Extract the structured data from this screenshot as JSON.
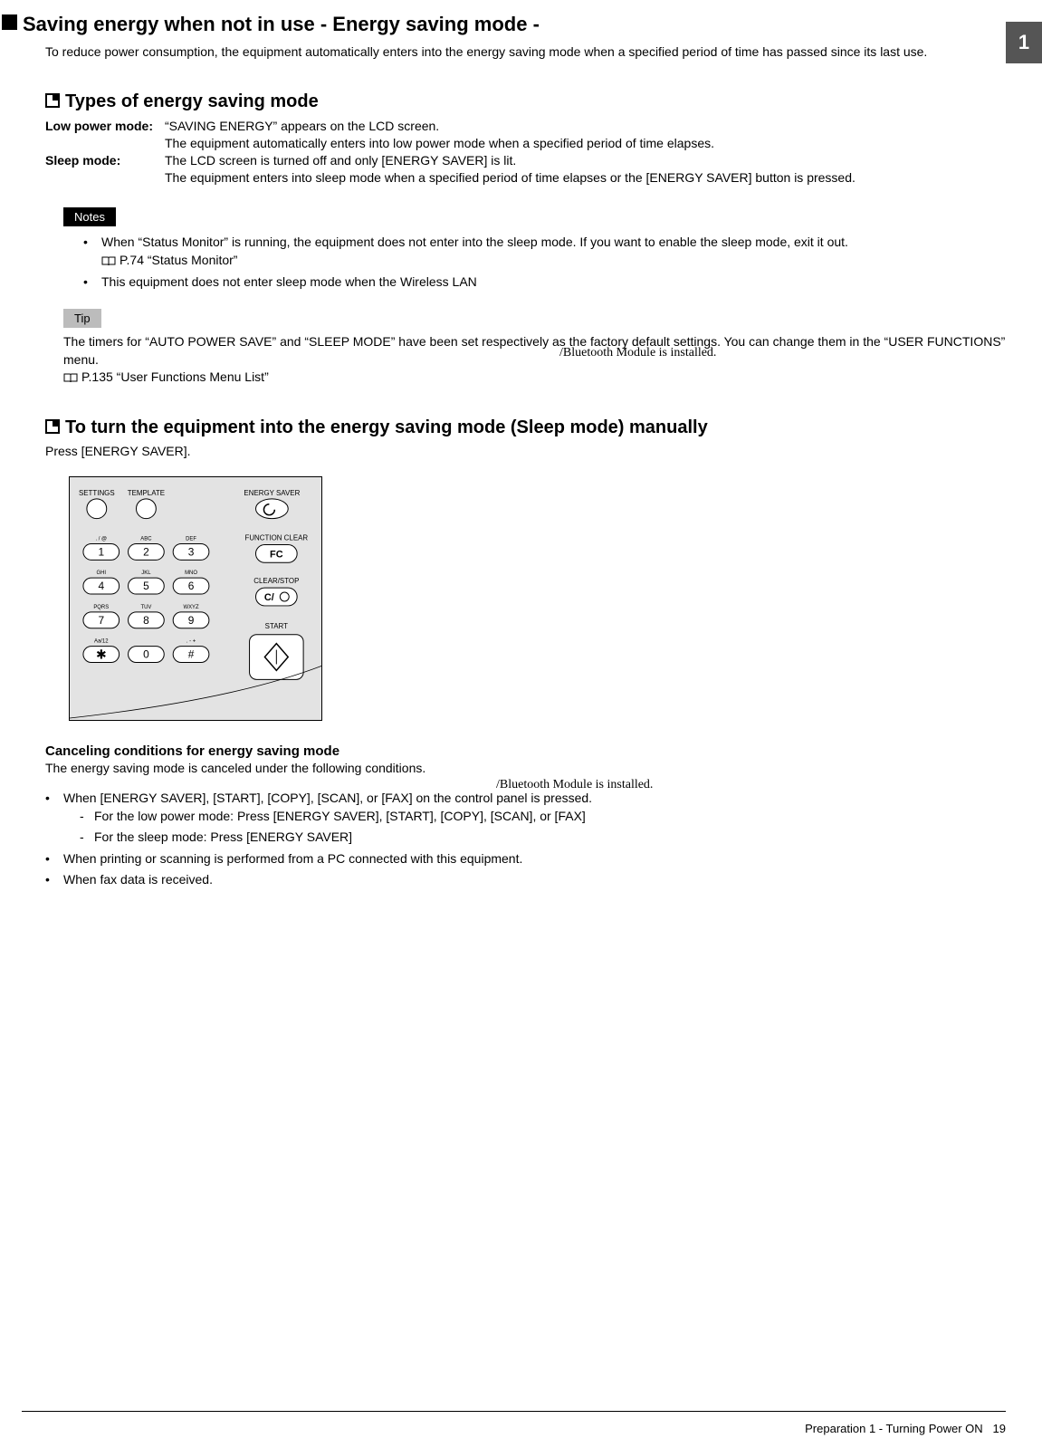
{
  "chapter_tab": "1",
  "section_title": "Saving energy when not in use - Energy saving mode -",
  "intro": "To reduce power consumption, the equipment automatically enters into the energy saving mode when a specified period of time has passed since its last use.",
  "types_heading": "Types of energy saving mode",
  "modes": {
    "low_label": "Low power mode:",
    "low_desc1": "“SAVING ENERGY” appears on the LCD screen.",
    "low_desc2": "The equipment automatically enters into low power mode when a specified period of time elapses.",
    "sleep_label": "Sleep mode:",
    "sleep_desc1": "The LCD screen is turned off and only [ENERGY SAVER] is lit.",
    "sleep_desc2": "The equipment enters into sleep mode when a specified period of time elapses or the [ENERGY SAVER] button is pressed."
  },
  "notes_label": "Notes",
  "notes": {
    "n1a": "When “Status Monitor” is running, the equipment does not enter into the sleep mode. If you want to enable the sleep mode, exit it out.",
    "n1b": "P.74 “Status Monitor”",
    "n2": "This equipment does not enter sleep mode when the Wireless LAN"
  },
  "tip_label": "Tip",
  "tip": {
    "t1": "The timers for “AUTO POWER SAVE” and “SLEEP MODE” have been set respectively as the factory default settings. You can change them in the “USER FUNCTIONS” menu.",
    "t2": "P.135 “User Functions Menu List”"
  },
  "manual_heading": "To turn the equipment into the energy saving mode (Sleep mode) manually",
  "press_line": "Press [ENERGY SAVER].",
  "panel": {
    "settings": "SETTINGS",
    "template": "TEMPLATE",
    "energy_saver": "ENERGY SAVER",
    "function_clear": "FUNCTION CLEAR",
    "fc": "FC",
    "clear_stop": "CLEAR/STOP",
    "c_btn": "C/",
    "start": "START",
    "k1sub": ". / @",
    "k2sub": "ABC",
    "k3sub": "DEF",
    "k4sub": "GHI",
    "k5sub": "JKL",
    "k6sub": "MNO",
    "k7sub": "PQRS",
    "k8sub": "TUV",
    "k9sub": "WXYZ",
    "kstarsub": "Aa/12",
    "khashsub": ". - +"
  },
  "cancel_head": "Canceling conditions for energy saving mode",
  "cancel_desc": "The energy saving mode is canceled under the following conditions.",
  "cancel": {
    "c1": "When [ENERGY SAVER], [START], [COPY], [SCAN], or [FAX] on the control panel is pressed.",
    "c1a": "For the low power mode: Press [ENERGY SAVER], [START], [COPY], [SCAN], or [FAX]",
    "c1b": "For the sleep mode: Press [ENERGY SAVER]",
    "c2": "When printing or scanning is performed from a PC connected with this equipment.",
    "c3": "When fax data is received."
  },
  "annot1": "/Bluetooth Module is installed.",
  "annot2": "/Bluetooth Module is installed.",
  "footer": {
    "text": "Preparation 1 - Turning Power ON",
    "page": "19"
  }
}
